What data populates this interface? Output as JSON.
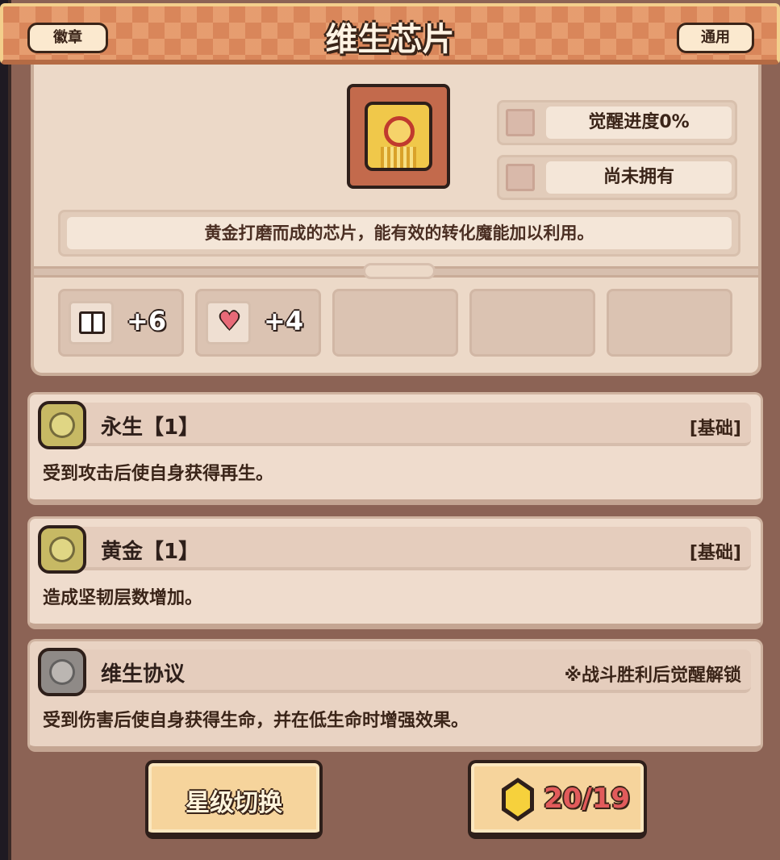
{
  "header": {
    "title": "维生芯片",
    "left_tag": "徽章",
    "right_tag": "通用"
  },
  "item": {
    "icon": "golden-chip-icon",
    "awaken_progress": "觉醒进度0%",
    "ownership": "尚未拥有",
    "description": "黄金打磨而成的芯片，能有效的转化魔能加以利用。"
  },
  "stats": [
    {
      "icon": "book-icon",
      "value": "+6"
    },
    {
      "icon": "heart-icon",
      "value": "+4"
    }
  ],
  "skills": [
    {
      "name": "永生【1】",
      "tag": "[基础]",
      "description": "受到攻击后使自身获得再生。",
      "icon": "immortal-skill-icon"
    },
    {
      "name": "黄金【1】",
      "tag": "[基础]",
      "description": "造成坚韧层数增加。",
      "icon": "gold-skill-icon"
    },
    {
      "name": "维生协议",
      "tag": "※战斗胜利后觉醒解锁",
      "description": "受到伤害后使自身获得生命，并在低生命时增强效果。",
      "icon": "life-protocol-skill-icon"
    }
  ],
  "buttons": {
    "star_switch": "星级切换",
    "cost": "20/19"
  },
  "colors": {
    "header": "#d9865a",
    "panel": "#ecd9c8",
    "frame": "#8c6355",
    "cost_text": "#e25b5b"
  }
}
